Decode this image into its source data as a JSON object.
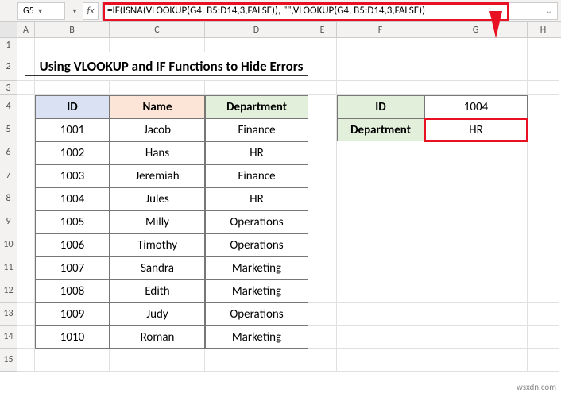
{
  "namebox": "G5",
  "fx_label": "fx",
  "formula": "=IF(ISNA(VLOOKUP(G4, B5:D14,3,FALSE)), \"\",VLOOKUP(G4, B5:D14,3,FALSE))",
  "columns": [
    "A",
    "B",
    "C",
    "D",
    "E",
    "F",
    "G",
    "H"
  ],
  "rows": [
    "1",
    "2",
    "3",
    "4",
    "5",
    "6",
    "7",
    "8",
    "9",
    "10",
    "11",
    "12",
    "13",
    "14",
    "15"
  ],
  "title": "Using VLOOKUP and IF Functions to Hide Errors",
  "table": {
    "headers": {
      "id": "ID",
      "name": "Name",
      "dept": "Department"
    },
    "rows": [
      {
        "id": "1001",
        "name": "Jacob",
        "dept": "Finance"
      },
      {
        "id": "1002",
        "name": "Hans",
        "dept": "HR"
      },
      {
        "id": "1003",
        "name": "Jeremiah",
        "dept": "Finance"
      },
      {
        "id": "1004",
        "name": "Jules",
        "dept": "HR"
      },
      {
        "id": "1005",
        "name": "Milly",
        "dept": "Operations"
      },
      {
        "id": "1006",
        "name": "Timothy",
        "dept": "Operations"
      },
      {
        "id": "1007",
        "name": "Sandra",
        "dept": "Marketing"
      },
      {
        "id": "1008",
        "name": "Edith",
        "dept": "Marketing"
      },
      {
        "id": "1009",
        "name": "Judy",
        "dept": "Operations"
      },
      {
        "id": "1010",
        "name": "Roman",
        "dept": "Marketing"
      }
    ]
  },
  "lookup": {
    "id_label": "ID",
    "id_value": "1004",
    "dept_label": "Department",
    "dept_value": "HR"
  },
  "watermark": "wsxdn.com"
}
